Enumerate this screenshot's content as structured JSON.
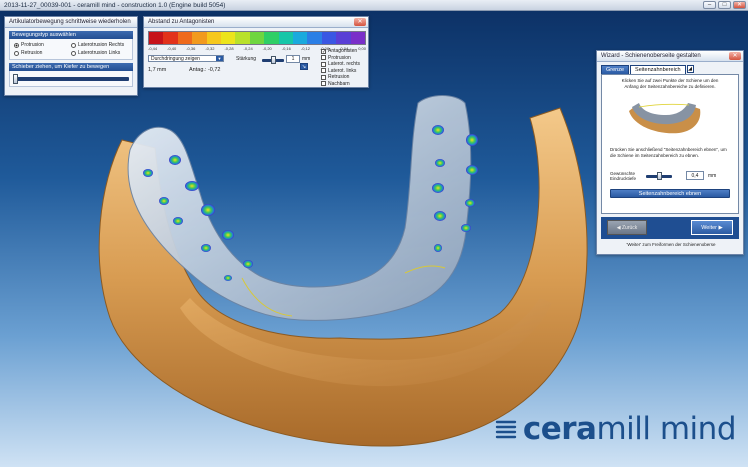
{
  "window": {
    "title": "2013-11-27_00039-001 - ceramill mind - construction 1.0 (Engine build 5054)",
    "minimize": "–",
    "maximize": "□",
    "close": "✕"
  },
  "articulator_panel": {
    "title": "Artikulatorbewegung schrittweise wiederholen",
    "movement_header": "Bewegungstyp auswählen",
    "radios": [
      {
        "label": "Protrusion",
        "selected": true
      },
      {
        "label": "Laterotrusion Rechts",
        "selected": false
      },
      {
        "label": "Retrusion",
        "selected": false
      },
      {
        "label": "Laterotrusion Links",
        "selected": false
      }
    ],
    "slider_header": "Schieber ziehen, um Kiefer zu bewegen",
    "slider_value": 0.0
  },
  "antagonist_panel": {
    "title": "Abstand zu Antagonisten",
    "scale_colors": [
      "#c7131a",
      "#e2321b",
      "#ef6a1c",
      "#f29a1e",
      "#f6c81d",
      "#ece41c",
      "#b9e12b",
      "#6fd640",
      "#2fcf66",
      "#17c6a8",
      "#1aaadd",
      "#2b7fe6",
      "#3a57e3",
      "#5a3fd6",
      "#7a2fc9"
    ],
    "scale_labels": [
      "-0,44",
      "-0,40",
      "-0,36",
      "-0,32",
      "-0,28",
      "-0,24",
      "-0,20",
      "-0,16",
      "-0,12",
      "-0,08",
      "-0,04",
      "0,00"
    ],
    "display_dropdown": "Durchdringung zeigen",
    "grading_label": "Stärkung",
    "grading_value": "1",
    "grading_unit": "mm",
    "value_left": "1,7 mm",
    "value_antag": "Antag.: -0,72",
    "checks": [
      {
        "label": "Antagonisten",
        "checked": true
      },
      {
        "label": "Protrusion",
        "checked": false
      },
      {
        "label": "Laterot. rechts",
        "checked": false
      },
      {
        "label": "Laterot. links",
        "checked": false
      },
      {
        "label": "Retrusion",
        "checked": false
      },
      {
        "label": "Nachbarn",
        "checked": false
      }
    ]
  },
  "wizard": {
    "title": "Wizard - Schienenoberseite gestalten",
    "tabs": [
      "Grenze",
      "Seitenzahnbereich"
    ],
    "active_tab": 1,
    "instruction": "Klicken Sie auf zwei Punkte der Schiene um den Anfang der Seitenzahnbereiche zu definieren.",
    "instruction2": "Drücken Sie anschließend \"Seitenzahnbereich ebnen\", um die Schiene im Seitenzahnbereich zu ebnen.",
    "depth_label": "Gewünschte Eindrucktiefe",
    "depth_value": "0,4",
    "depth_unit": "mm",
    "flatten_button": "Seitenzahnbereich ebnen",
    "back_button": "Zurück",
    "next_button": "Weiter",
    "footer": "'Weiter' zum Freiformen der Schienenoberse"
  },
  "brand": {
    "name_bold": "cera",
    "name_regular": "mill mind"
  }
}
